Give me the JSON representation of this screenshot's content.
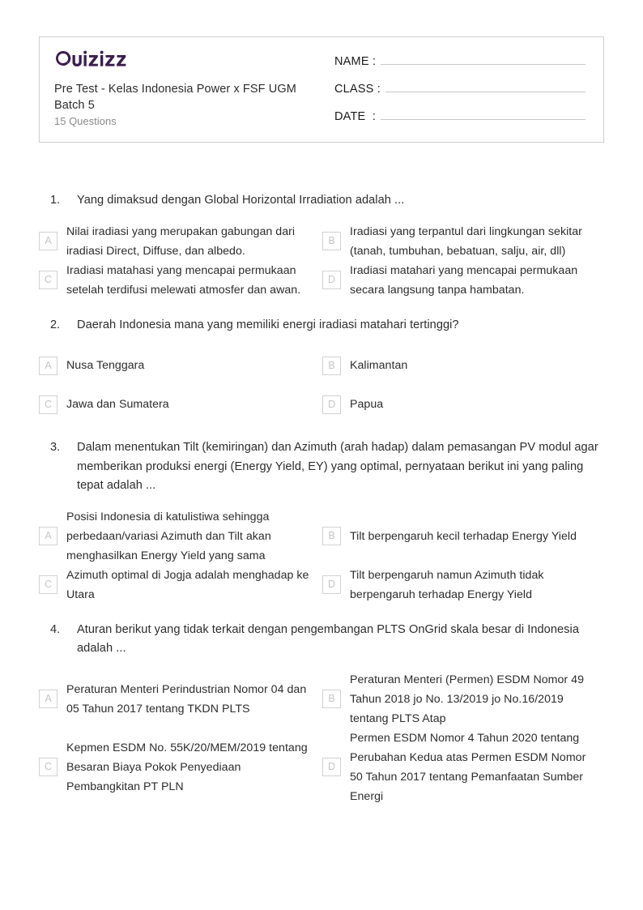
{
  "header": {
    "logo_text": "Quizizz",
    "logo_color": "#3b1d4e",
    "title": "Pre Test - Kelas Indonesia Power x FSF UGM Batch 5",
    "subtitle": "15 Questions",
    "fields": [
      {
        "label": "NAME :"
      },
      {
        "label": "CLASS :"
      },
      {
        "label": "DATE  :"
      }
    ]
  },
  "questions": [
    {
      "number": "1.",
      "text": "Yang dimaksud dengan Global Horizontal Irradiation adalah ...",
      "options": [
        {
          "letter": "A",
          "text": "Nilai iradiasi yang merupakan gabungan dari iradiasi Direct, Diffuse, dan albedo."
        },
        {
          "letter": "B",
          "text": "Iradiasi yang terpantul dari lingkungan sekitar (tanah, tumbuhan, bebatuan, salju, air, dll)"
        },
        {
          "letter": "C",
          "text": "Iradiasi matahasi yang mencapai permukaan setelah terdifusi melewati atmosfer dan awan."
        },
        {
          "letter": "D",
          "text": "Iradiasi matahari yang mencapai permukaan secara langsung tanpa hambatan."
        }
      ]
    },
    {
      "number": "2.",
      "text": "Daerah Indonesia mana yang memiliki energi iradiasi matahari tertinggi?",
      "options": [
        {
          "letter": "A",
          "text": "Nusa Tenggara"
        },
        {
          "letter": "B",
          "text": "Kalimantan"
        },
        {
          "letter": "C",
          "text": "Jawa dan Sumatera"
        },
        {
          "letter": "D",
          "text": "Papua"
        }
      ]
    },
    {
      "number": "3.",
      "text": "Dalam menentukan Tilt (kemiringan) dan Azimuth (arah hadap) dalam pemasangan PV modul agar memberikan produksi energi (Energy Yield, EY) yang optimal, pernyataan berikut ini yang paling tepat adalah ...",
      "options": [
        {
          "letter": "A",
          "text": "Posisi Indonesia di katulistiwa sehingga perbedaan/variasi Azimuth dan Tilt akan menghasilkan Energy Yield yang sama"
        },
        {
          "letter": "B",
          "text": "Tilt berpengaruh kecil terhadap Energy Yield"
        },
        {
          "letter": "C",
          "text": "Azimuth optimal di Jogja adalah menghadap ke Utara"
        },
        {
          "letter": "D",
          "text": "Tilt berpengaruh namun Azimuth tidak berpengaruh terhadap Energy Yield"
        }
      ]
    },
    {
      "number": "4.",
      "text": "Aturan berikut yang tidak terkait dengan pengembangan PLTS OnGrid skala besar di Indonesia adalah ...",
      "options": [
        {
          "letter": "A",
          "text": "Peraturan Menteri Perindustrian Nomor 04 dan 05 Tahun 2017 tentang TKDN PLTS"
        },
        {
          "letter": "B",
          "text": "Peraturan Menteri (Permen) ESDM Nomor 49 Tahun 2018 jo No. 13/2019 jo No.16/2019 tentang PLTS Atap"
        },
        {
          "letter": "C",
          "text": "Kepmen ESDM No. 55K/20/MEM/2019 tentang Besaran Biaya Pokok Penyediaan Pembangkitan PT PLN"
        },
        {
          "letter": "D",
          "text": "Permen ESDM Nomor 4 Tahun 2020 tentang Perubahan Kedua atas Permen ESDM Nomor 50 Tahun 2017 tentang Pemanfaatan Sumber Energi"
        }
      ]
    }
  ]
}
